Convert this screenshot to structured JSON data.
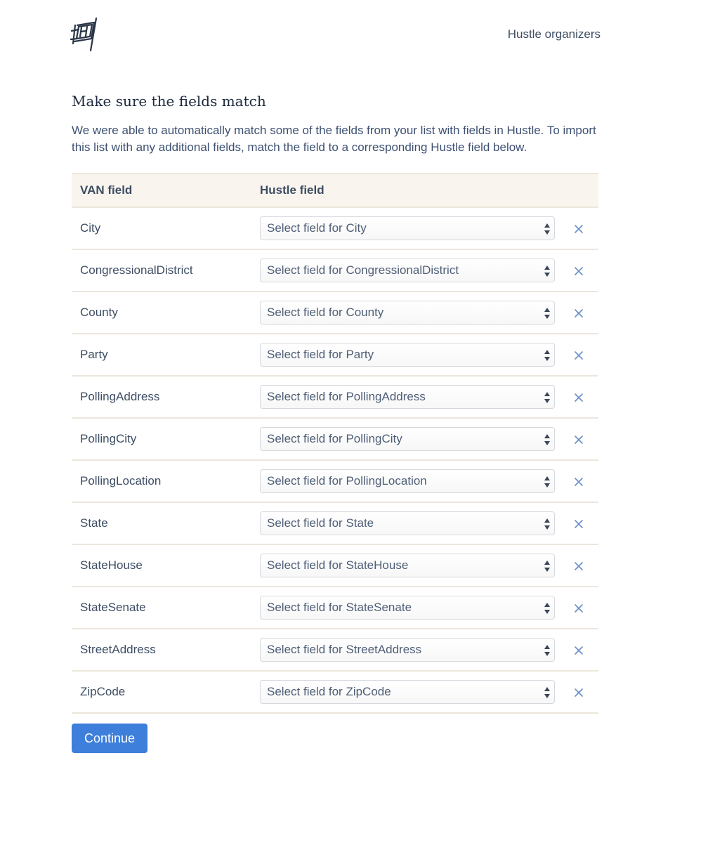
{
  "header": {
    "nav_link": "Hustle organizers"
  },
  "main": {
    "title": "Make sure the fields match",
    "intro": "We were able to automatically match some of the fields from your list with fields in Hustle. To import this list with any additional fields, match the field to a corresponding Hustle field below.",
    "table": {
      "headers": [
        "VAN field",
        "Hustle field",
        ""
      ],
      "rows": [
        {
          "van_field": "City",
          "select_placeholder": "Select field for City"
        },
        {
          "van_field": "CongressionalDistrict",
          "select_placeholder": "Select field for CongressionalDistrict"
        },
        {
          "van_field": "County",
          "select_placeholder": "Select field for County"
        },
        {
          "van_field": "Party",
          "select_placeholder": "Select field for Party"
        },
        {
          "van_field": "PollingAddress",
          "select_placeholder": "Select field for PollingAddress"
        },
        {
          "van_field": "PollingCity",
          "select_placeholder": "Select field for PollingCity"
        },
        {
          "van_field": "PollingLocation",
          "select_placeholder": "Select field for PollingLocation"
        },
        {
          "van_field": "State",
          "select_placeholder": "Select field for State"
        },
        {
          "van_field": "StateHouse",
          "select_placeholder": "Select field for StateHouse"
        },
        {
          "van_field": "StateSenate",
          "select_placeholder": "Select field for StateSenate"
        },
        {
          "van_field": "StreetAddress",
          "select_placeholder": "Select field for StreetAddress"
        },
        {
          "van_field": "ZipCode",
          "select_placeholder": "Select field for ZipCode"
        }
      ]
    },
    "continue_label": "Continue"
  },
  "icons": {
    "logo": "hustle-flag-logo-icon",
    "select_arrows": "select-arrows-icon",
    "remove": "close-icon"
  },
  "colors": {
    "accent": "#3d7fdb",
    "header_bg": "#f9f4ee",
    "text": "#3d4d63",
    "remove_icon": "#6a8fc9"
  }
}
